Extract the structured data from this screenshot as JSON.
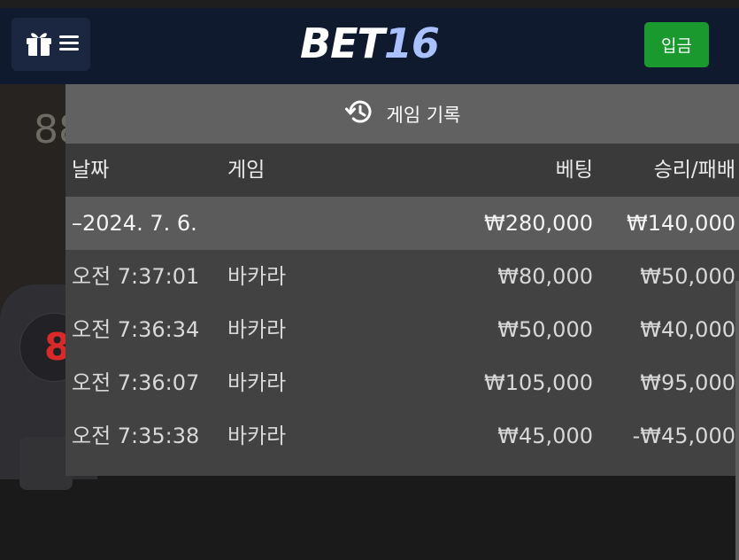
{
  "header": {
    "menu_icon": "gift-menu-icon",
    "logo_part1": "BET",
    "logo_part2": "16",
    "deposit_label": "입금"
  },
  "background": {
    "number_text": "88",
    "badge_text": "8"
  },
  "history": {
    "title": "게임 기록",
    "title_icon": "history-icon",
    "columns": [
      "날짜",
      "게임",
      "베팅",
      "승리/패배"
    ],
    "date_row": {
      "date": "–2024. 7. 6.",
      "bet": "₩280,000",
      "result": "₩140,000"
    },
    "rows": [
      {
        "time": "오전 7:37:01",
        "game": "바카라",
        "bet": "₩80,000",
        "result": "₩50,000"
      },
      {
        "time": "오전 7:36:34",
        "game": "바카라",
        "bet": "₩50,000",
        "result": "₩40,000"
      },
      {
        "time": "오전 7:36:07",
        "game": "바카라",
        "bet": "₩105,000",
        "result": "₩95,000"
      },
      {
        "time": "오전 7:35:38",
        "game": "바카라",
        "bet": "₩45,000",
        "result": "-₩45,000"
      }
    ]
  },
  "colors": {
    "header_bg": "#0f1a2e",
    "deposit_green": "#1a9a2e",
    "logo_accent": "#a9c2ff",
    "panel_bg": "#424242",
    "panel_header_bg": "#616161"
  }
}
